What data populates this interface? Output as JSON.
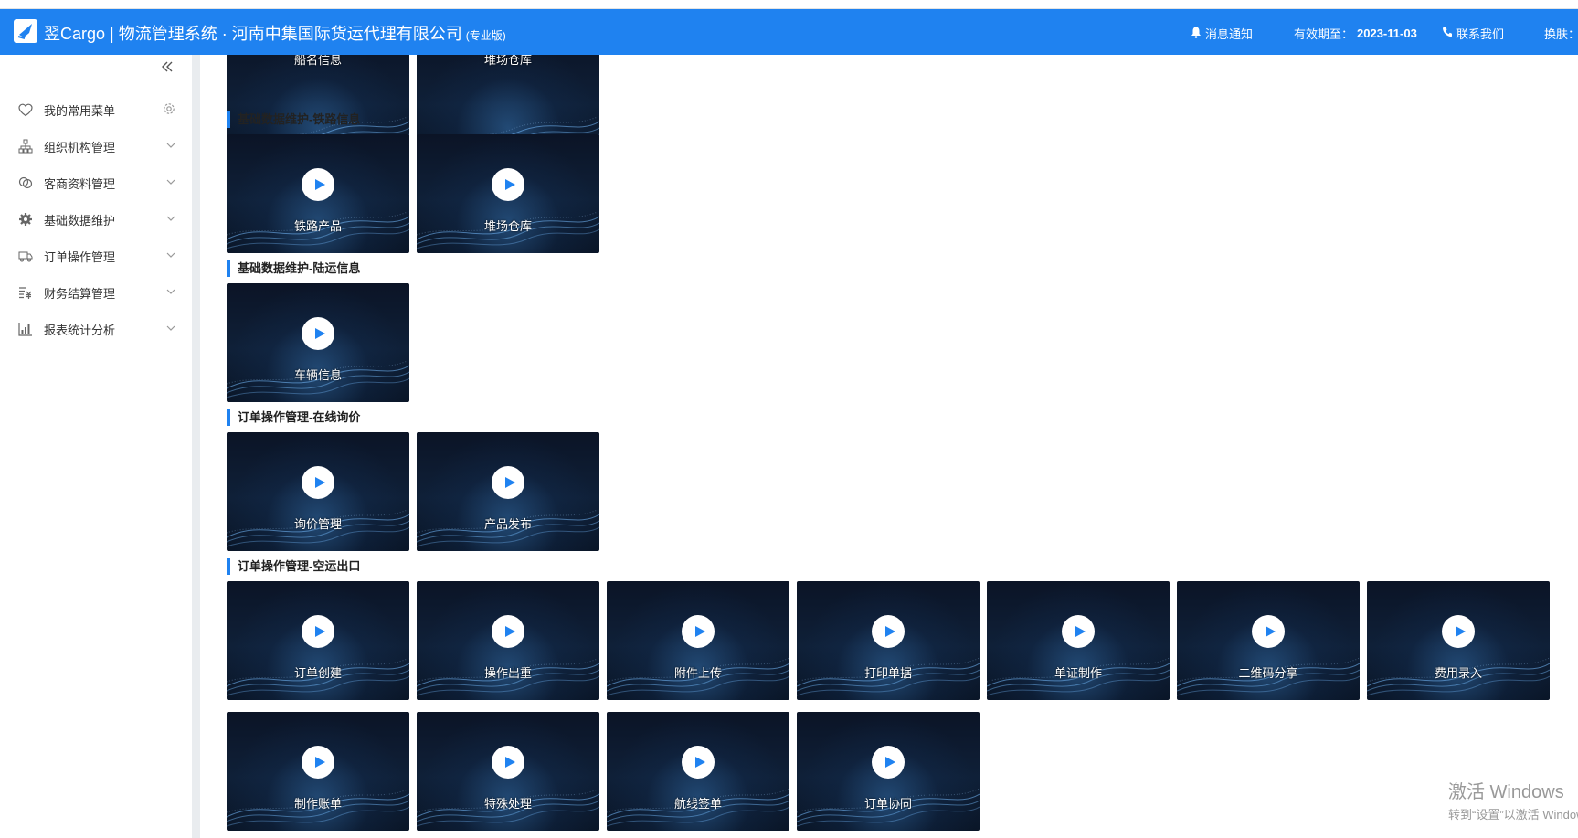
{
  "header": {
    "title": "翌Cargo | 物流管理系统 · 河南中集国际货运代理有限公司",
    "edition": "(专业版)",
    "notice": "消息通知",
    "valid_label": "有效期至：",
    "valid_date": "2023-11-03",
    "contact": "联系我们",
    "skin": "换肤：",
    "brand_color": "#1f82f0"
  },
  "sidebar": {
    "items": [
      {
        "label": "我的常用菜单",
        "icon": "heart-icon"
      },
      {
        "label": "组织机构管理",
        "icon": "org-icon"
      },
      {
        "label": "客商资料管理",
        "icon": "link-icon"
      },
      {
        "label": "基础数据维护",
        "icon": "gear-icon"
      },
      {
        "label": "订单操作管理",
        "icon": "truck-icon"
      },
      {
        "label": "财务结算管理",
        "icon": "money-icon"
      },
      {
        "label": "报表统计分析",
        "icon": "chart-icon"
      }
    ]
  },
  "sections": [
    {
      "title": "",
      "videos": [
        "船名信息",
        "堆场仓库"
      ]
    },
    {
      "title": "基础数据维护-铁路信息",
      "videos": [
        "铁路产品",
        "堆场仓库"
      ]
    },
    {
      "title": "基础数据维护-陆运信息",
      "videos": [
        "车辆信息"
      ]
    },
    {
      "title": "订单操作管理-在线询价",
      "videos": [
        "询价管理",
        "产品发布"
      ]
    },
    {
      "title": "订单操作管理-空运出口",
      "videos": [
        "订单创建",
        "操作出重",
        "附件上传",
        "打印单据",
        "单证制作",
        "二维码分享",
        "费用录入",
        "制作账单",
        "特殊处理",
        "航线签单",
        "订单协同"
      ]
    }
  ],
  "watermark": {
    "line1": "激活 Windows",
    "line2": "转到“设置”以激活 Windows。"
  }
}
